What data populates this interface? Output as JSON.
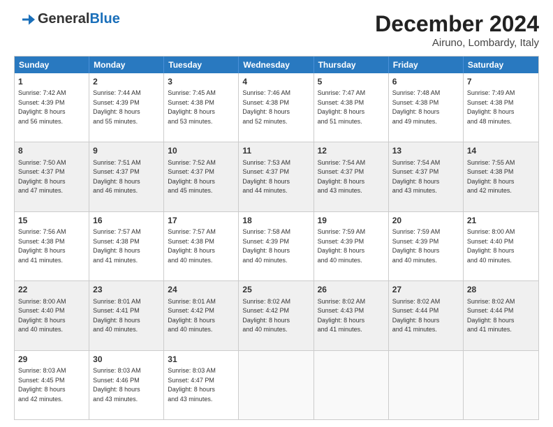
{
  "header": {
    "logo_general": "General",
    "logo_blue": "Blue",
    "month_title": "December 2024",
    "location": "Airuno, Lombardy, Italy"
  },
  "weekdays": [
    "Sunday",
    "Monday",
    "Tuesday",
    "Wednesday",
    "Thursday",
    "Friday",
    "Saturday"
  ],
  "rows": [
    [
      {
        "day": "1",
        "lines": [
          "Sunrise: 7:42 AM",
          "Sunset: 4:39 PM",
          "Daylight: 8 hours",
          "and 56 minutes."
        ],
        "shaded": false
      },
      {
        "day": "2",
        "lines": [
          "Sunrise: 7:44 AM",
          "Sunset: 4:39 PM",
          "Daylight: 8 hours",
          "and 55 minutes."
        ],
        "shaded": false
      },
      {
        "day": "3",
        "lines": [
          "Sunrise: 7:45 AM",
          "Sunset: 4:38 PM",
          "Daylight: 8 hours",
          "and 53 minutes."
        ],
        "shaded": false
      },
      {
        "day": "4",
        "lines": [
          "Sunrise: 7:46 AM",
          "Sunset: 4:38 PM",
          "Daylight: 8 hours",
          "and 52 minutes."
        ],
        "shaded": false
      },
      {
        "day": "5",
        "lines": [
          "Sunrise: 7:47 AM",
          "Sunset: 4:38 PM",
          "Daylight: 8 hours",
          "and 51 minutes."
        ],
        "shaded": false
      },
      {
        "day": "6",
        "lines": [
          "Sunrise: 7:48 AM",
          "Sunset: 4:38 PM",
          "Daylight: 8 hours",
          "and 49 minutes."
        ],
        "shaded": false
      },
      {
        "day": "7",
        "lines": [
          "Sunrise: 7:49 AM",
          "Sunset: 4:38 PM",
          "Daylight: 8 hours",
          "and 48 minutes."
        ],
        "shaded": false
      }
    ],
    [
      {
        "day": "8",
        "lines": [
          "Sunrise: 7:50 AM",
          "Sunset: 4:37 PM",
          "Daylight: 8 hours",
          "and 47 minutes."
        ],
        "shaded": true
      },
      {
        "day": "9",
        "lines": [
          "Sunrise: 7:51 AM",
          "Sunset: 4:37 PM",
          "Daylight: 8 hours",
          "and 46 minutes."
        ],
        "shaded": true
      },
      {
        "day": "10",
        "lines": [
          "Sunrise: 7:52 AM",
          "Sunset: 4:37 PM",
          "Daylight: 8 hours",
          "and 45 minutes."
        ],
        "shaded": true
      },
      {
        "day": "11",
        "lines": [
          "Sunrise: 7:53 AM",
          "Sunset: 4:37 PM",
          "Daylight: 8 hours",
          "and 44 minutes."
        ],
        "shaded": true
      },
      {
        "day": "12",
        "lines": [
          "Sunrise: 7:54 AM",
          "Sunset: 4:37 PM",
          "Daylight: 8 hours",
          "and 43 minutes."
        ],
        "shaded": true
      },
      {
        "day": "13",
        "lines": [
          "Sunrise: 7:54 AM",
          "Sunset: 4:37 PM",
          "Daylight: 8 hours",
          "and 43 minutes."
        ],
        "shaded": true
      },
      {
        "day": "14",
        "lines": [
          "Sunrise: 7:55 AM",
          "Sunset: 4:38 PM",
          "Daylight: 8 hours",
          "and 42 minutes."
        ],
        "shaded": true
      }
    ],
    [
      {
        "day": "15",
        "lines": [
          "Sunrise: 7:56 AM",
          "Sunset: 4:38 PM",
          "Daylight: 8 hours",
          "and 41 minutes."
        ],
        "shaded": false
      },
      {
        "day": "16",
        "lines": [
          "Sunrise: 7:57 AM",
          "Sunset: 4:38 PM",
          "Daylight: 8 hours",
          "and 41 minutes."
        ],
        "shaded": false
      },
      {
        "day": "17",
        "lines": [
          "Sunrise: 7:57 AM",
          "Sunset: 4:38 PM",
          "Daylight: 8 hours",
          "and 40 minutes."
        ],
        "shaded": false
      },
      {
        "day": "18",
        "lines": [
          "Sunrise: 7:58 AM",
          "Sunset: 4:39 PM",
          "Daylight: 8 hours",
          "and 40 minutes."
        ],
        "shaded": false
      },
      {
        "day": "19",
        "lines": [
          "Sunrise: 7:59 AM",
          "Sunset: 4:39 PM",
          "Daylight: 8 hours",
          "and 40 minutes."
        ],
        "shaded": false
      },
      {
        "day": "20",
        "lines": [
          "Sunrise: 7:59 AM",
          "Sunset: 4:39 PM",
          "Daylight: 8 hours",
          "and 40 minutes."
        ],
        "shaded": false
      },
      {
        "day": "21",
        "lines": [
          "Sunrise: 8:00 AM",
          "Sunset: 4:40 PM",
          "Daylight: 8 hours",
          "and 40 minutes."
        ],
        "shaded": false
      }
    ],
    [
      {
        "day": "22",
        "lines": [
          "Sunrise: 8:00 AM",
          "Sunset: 4:40 PM",
          "Daylight: 8 hours",
          "and 40 minutes."
        ],
        "shaded": true
      },
      {
        "day": "23",
        "lines": [
          "Sunrise: 8:01 AM",
          "Sunset: 4:41 PM",
          "Daylight: 8 hours",
          "and 40 minutes."
        ],
        "shaded": true
      },
      {
        "day": "24",
        "lines": [
          "Sunrise: 8:01 AM",
          "Sunset: 4:42 PM",
          "Daylight: 8 hours",
          "and 40 minutes."
        ],
        "shaded": true
      },
      {
        "day": "25",
        "lines": [
          "Sunrise: 8:02 AM",
          "Sunset: 4:42 PM",
          "Daylight: 8 hours",
          "and 40 minutes."
        ],
        "shaded": true
      },
      {
        "day": "26",
        "lines": [
          "Sunrise: 8:02 AM",
          "Sunset: 4:43 PM",
          "Daylight: 8 hours",
          "and 41 minutes."
        ],
        "shaded": true
      },
      {
        "day": "27",
        "lines": [
          "Sunrise: 8:02 AM",
          "Sunset: 4:44 PM",
          "Daylight: 8 hours",
          "and 41 minutes."
        ],
        "shaded": true
      },
      {
        "day": "28",
        "lines": [
          "Sunrise: 8:02 AM",
          "Sunset: 4:44 PM",
          "Daylight: 8 hours",
          "and 41 minutes."
        ],
        "shaded": true
      }
    ],
    [
      {
        "day": "29",
        "lines": [
          "Sunrise: 8:03 AM",
          "Sunset: 4:45 PM",
          "Daylight: 8 hours",
          "and 42 minutes."
        ],
        "shaded": false
      },
      {
        "day": "30",
        "lines": [
          "Sunrise: 8:03 AM",
          "Sunset: 4:46 PM",
          "Daylight: 8 hours",
          "and 43 minutes."
        ],
        "shaded": false
      },
      {
        "day": "31",
        "lines": [
          "Sunrise: 8:03 AM",
          "Sunset: 4:47 PM",
          "Daylight: 8 hours",
          "and 43 minutes."
        ],
        "shaded": false
      },
      {
        "day": "",
        "lines": [],
        "shaded": false,
        "empty": true
      },
      {
        "day": "",
        "lines": [],
        "shaded": false,
        "empty": true
      },
      {
        "day": "",
        "lines": [],
        "shaded": false,
        "empty": true
      },
      {
        "day": "",
        "lines": [],
        "shaded": false,
        "empty": true
      }
    ]
  ]
}
